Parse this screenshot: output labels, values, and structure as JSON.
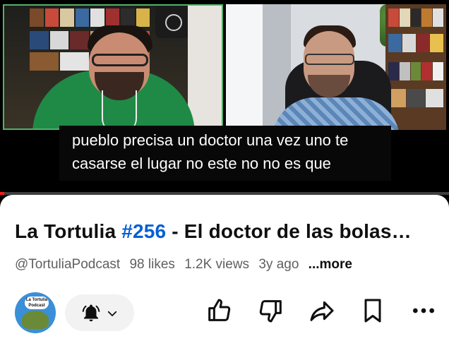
{
  "caption": {
    "line1": "pueblo precisa un doctor una vez uno te",
    "line2": "casarse el lugar no este no no es que"
  },
  "video": {
    "title_prefix": "La Tortulia ",
    "title_tag": "#256",
    "title_rest": " - El doctor de las bolas…",
    "progress_fraction": 0.01
  },
  "meta": {
    "channel": "@TortuliaPodcast",
    "likes": "98 likes",
    "views": "1.2K views",
    "age": "3y ago",
    "more": "...more"
  },
  "channel_avatar": {
    "logo_text": "La Tortulia Podcast"
  },
  "actions": {
    "icons": [
      "bell-icon",
      "chevron-down-icon",
      "thumbs-up-icon",
      "thumbs-down-icon",
      "share-icon",
      "save-icon",
      "more-icon"
    ]
  },
  "colors": {
    "accent_link": "#065fd4",
    "progress": "#ff1a1a",
    "tile_highlight": "#4fb36a"
  }
}
